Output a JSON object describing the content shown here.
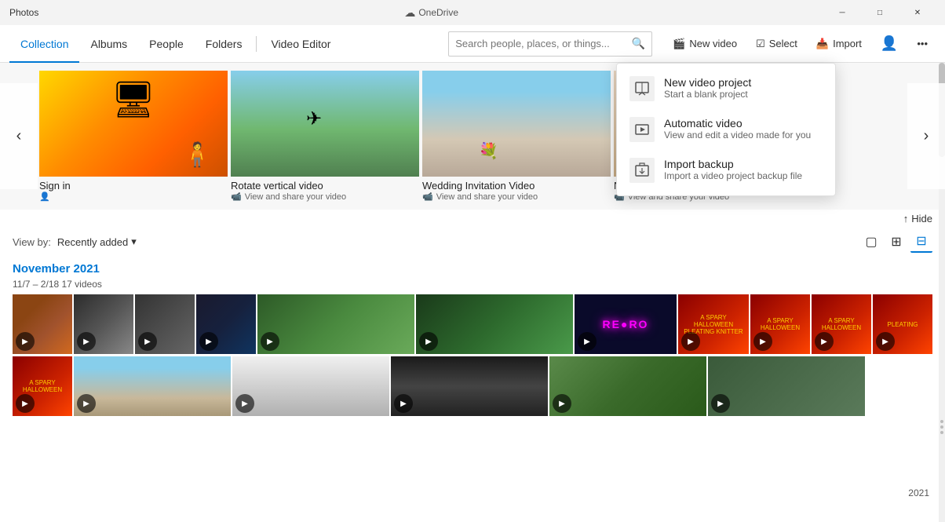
{
  "app": {
    "title": "Photos",
    "onedrive_label": "OneDrive"
  },
  "window_controls": {
    "minimize": "─",
    "maximize": "□",
    "close": "✕"
  },
  "nav": {
    "items": [
      {
        "label": "Collection",
        "active": true
      },
      {
        "label": "Albums",
        "active": false
      },
      {
        "label": "People",
        "active": false
      },
      {
        "label": "Folders",
        "active": false
      },
      {
        "label": "Video Editor",
        "active": false
      }
    ],
    "search_placeholder": "Search people, places, or things...",
    "actions": [
      {
        "label": "New video",
        "icon": "🎬"
      },
      {
        "label": "Select",
        "icon": "☑"
      },
      {
        "label": "Import",
        "icon": "📥"
      }
    ]
  },
  "featured": {
    "prev_label": "<",
    "next_label": ">",
    "items": [
      {
        "title": "Sign in",
        "subtitle": "",
        "has_icon": true
      },
      {
        "title": "Rotate vertical video",
        "subtitle": "View and share your video",
        "has_video_icon": true
      },
      {
        "title": "Wedding Invitation Video",
        "subtitle": "View and share your video",
        "has_video_icon": true
      },
      {
        "title": "New video",
        "subtitle": "View and share your video",
        "has_video_icon": true
      }
    ]
  },
  "hide_button": "Hide",
  "view_controls": {
    "view_by_label": "View by:",
    "view_by_value": "Recently added",
    "layout_icons": [
      "large",
      "medium",
      "small"
    ]
  },
  "section": {
    "title": "November 2021",
    "subtitle": "11/7 – 2/18   17 videos"
  },
  "dropdown": {
    "items": [
      {
        "title": "New video project",
        "subtitle": "Start a blank project",
        "icon": "🎬"
      },
      {
        "title": "Automatic video",
        "subtitle": "View and edit a video made for you",
        "icon": "✨"
      },
      {
        "title": "Import backup",
        "subtitle": "Import a video project backup file",
        "icon": "📂"
      }
    ]
  },
  "scrollbar": {
    "year_label": "2021"
  }
}
